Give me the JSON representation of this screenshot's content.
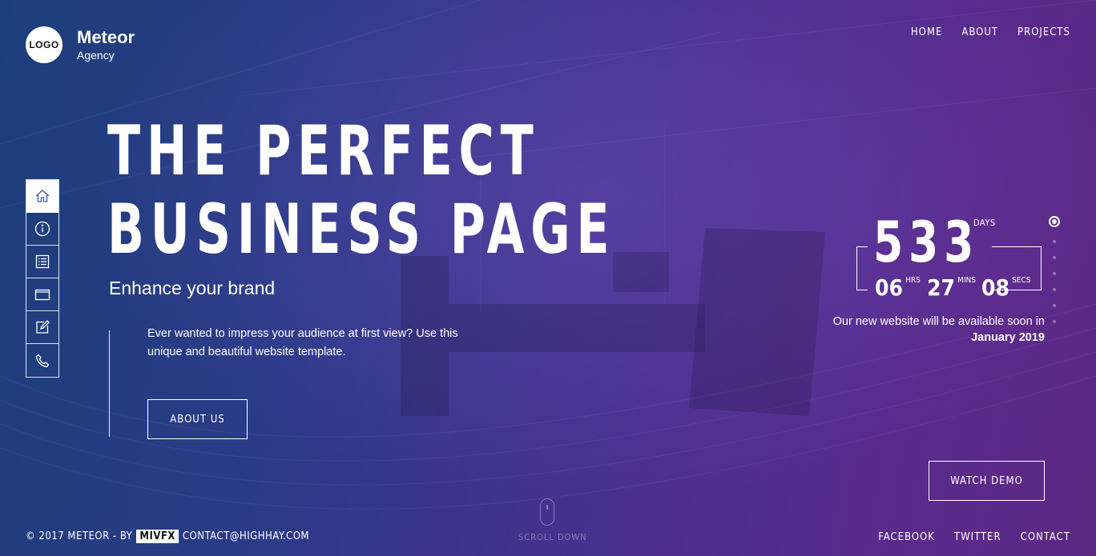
{
  "brand": {
    "logo_text": "LOGO",
    "name": "Meteor",
    "tagline": "Agency"
  },
  "top_nav": [
    {
      "label": "HOME"
    },
    {
      "label": "ABOUT"
    },
    {
      "label": "PROJECTS"
    }
  ],
  "side_nav": {
    "items": [
      {
        "icon": "home-icon",
        "active": true
      },
      {
        "icon": "info-icon",
        "active": false
      },
      {
        "icon": "list-icon",
        "active": false
      },
      {
        "icon": "folder-icon",
        "active": false
      },
      {
        "icon": "edit-icon",
        "active": false
      },
      {
        "icon": "phone-icon",
        "active": false
      }
    ]
  },
  "hero": {
    "title_line1": "THE PERFECT",
    "title_line2": "BUSINESS PAGE",
    "subtitle": "Enhance your brand",
    "description": "Ever wanted to impress your audience at first view? Use this unique and beautiful website template.",
    "cta_label": "ABOUT US"
  },
  "countdown": {
    "days": "533",
    "days_label": "DAYS",
    "hours": "06",
    "hours_label": "HRS",
    "minutes": "27",
    "minutes_label": "MINS",
    "seconds": "08",
    "seconds_label": "SECS",
    "note": "Our new website will be available soon in",
    "date": "January 2019"
  },
  "demo": {
    "label": "WATCH DEMO"
  },
  "pager": {
    "total": 7,
    "active_index": 0
  },
  "footer": {
    "copyright": "© 2017 METEOR - BY",
    "badge": "MIVFX",
    "contact": "CONTACT@HIGHHAY.COM",
    "scroll_label": "SCROLL DOWN",
    "links": [
      {
        "label": "FACEBOOK"
      },
      {
        "label": "TWITTER"
      },
      {
        "label": "CONTACT"
      }
    ]
  },
  "colors": {
    "bg_start": "#1c3f7a",
    "bg_end": "#5c2885",
    "accent": "#ffffff"
  }
}
